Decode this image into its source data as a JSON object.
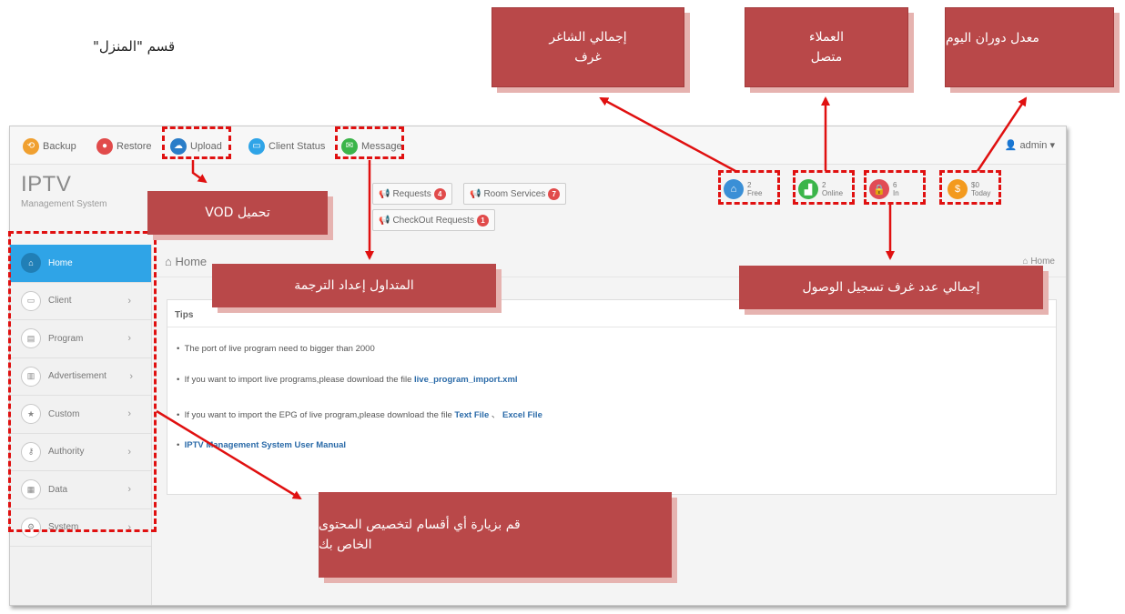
{
  "caption": "قسم \"المنزل\"",
  "callouts": {
    "total_vacant": [
      "إجمالي الشاغر",
      "غرف"
    ],
    "customers_online": [
      "العملاء",
      "متصل"
    ],
    "turnover": "معدل دوران اليوم",
    "vod_upload": "تحميل VOD",
    "subtitle_setting": "المتداول إعداد الترجمة",
    "checkin_rooms": "إجمالي عدد غرف تسجيل الوصول",
    "visit_sections": [
      "قم بزيارة أي أقسام لتخصيص المحتوى",
      "الخاص بك"
    ]
  },
  "toolbar": {
    "backup": "Backup",
    "restore": "Restore",
    "upload": "Upload",
    "client_status": "Client Status",
    "message": "Message",
    "admin": "admin ▾"
  },
  "brand": {
    "title": "IPTV",
    "subtitle": "Management System"
  },
  "requests": {
    "requests_label": "Requests",
    "requests_count": "4",
    "room_services_label": "Room Services",
    "room_services_count": "7",
    "checkout_label": "CheckOut Requests",
    "checkout_count": "1"
  },
  "stats": [
    {
      "value": "2",
      "label": "Free",
      "color": "#3a8fd6",
      "icon": "home-icon"
    },
    {
      "value": "2",
      "label": "Online",
      "color": "#3bb54a",
      "icon": "signal-icon"
    },
    {
      "value": "6",
      "label": "In",
      "color": "#e14b55",
      "icon": "lock-icon"
    },
    {
      "value": "$0",
      "label": "Today",
      "color": "#f39a1e",
      "icon": "money-icon"
    }
  ],
  "sidebar": [
    {
      "label": "Home",
      "icon": "home-icon",
      "active": true
    },
    {
      "label": "Client",
      "icon": "monitor-icon"
    },
    {
      "label": "Program",
      "icon": "film-icon"
    },
    {
      "label": "Advertisement",
      "icon": "chart-icon"
    },
    {
      "label": "Custom",
      "icon": "star-icon"
    },
    {
      "label": "Authority",
      "icon": "key-icon"
    },
    {
      "label": "Data",
      "icon": "bar-chart-icon"
    },
    {
      "label": "System",
      "icon": "gear-icon"
    }
  ],
  "breadcrumb": {
    "title": "Home",
    "right": "Home"
  },
  "tips": {
    "heading": "Tips",
    "line1": "The port of live program need to bigger than 2000",
    "line2_text": "If you want to import live programs,please download the file ",
    "line2_link": "live_program_import.xml",
    "line3_text": "If you want to import the EPG of live program,please download the file ",
    "line3_link1": "Text File",
    "line3_sep": " 、 ",
    "line3_link2": "Excel File",
    "line4_link": "IPTV Management System User Manual"
  }
}
